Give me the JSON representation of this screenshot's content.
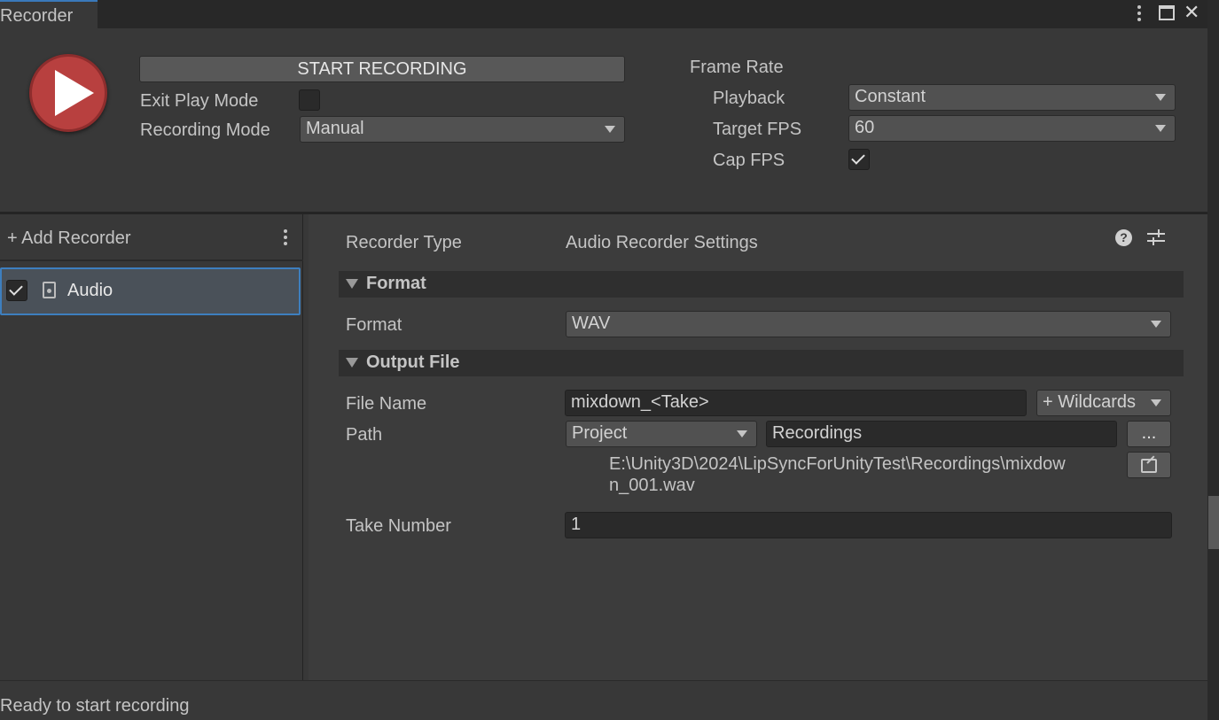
{
  "window": {
    "tab_title": "Recorder",
    "menu_icon": "kebab-icon",
    "maximize_icon": "maximize-icon",
    "close_icon": "close-icon"
  },
  "toolbar": {
    "start_recording_label": "START RECORDING",
    "exit_play_mode_label": "Exit Play Mode",
    "exit_play_mode_checked": false,
    "recording_mode_label": "Recording Mode",
    "recording_mode_value": "Manual",
    "frame_rate_label": "Frame Rate",
    "playback_label": "Playback",
    "playback_value": "Constant",
    "target_fps_label": "Target FPS",
    "target_fps_value": "60",
    "cap_fps_label": "Cap FPS",
    "cap_fps_checked": true
  },
  "recorder_list": {
    "add_recorder_label": "+ Add Recorder",
    "items": [
      {
        "label": "Audio",
        "enabled": true,
        "icon": "audio-file-icon",
        "selected": true
      }
    ]
  },
  "inspector": {
    "recorder_type_label": "Recorder Type",
    "recorder_type_value": "Audio Recorder Settings",
    "help_icon": "help-icon",
    "preset_icon": "preset-sliders-icon",
    "format_section": {
      "title": "Format",
      "format_label": "Format",
      "format_value": "WAV"
    },
    "output_section": {
      "title": "Output File",
      "file_name_label": "File Name",
      "file_name_value": "mixdown_<Take>",
      "wildcards_label": "+ Wildcards",
      "path_label": "Path",
      "path_root_value": "Project",
      "path_folder_value": "Recordings",
      "browse_label": "...",
      "resolved_path_line1": "E:\\Unity3D\\2024\\LipSyncForUnityTest\\Recordings\\mixdow",
      "resolved_path_line2": "n_001.wav",
      "reveal_icon": "open-external-icon"
    },
    "take_number_label": "Take Number",
    "take_number_value": "1"
  },
  "status_bar": {
    "message": "Ready to start recording"
  }
}
